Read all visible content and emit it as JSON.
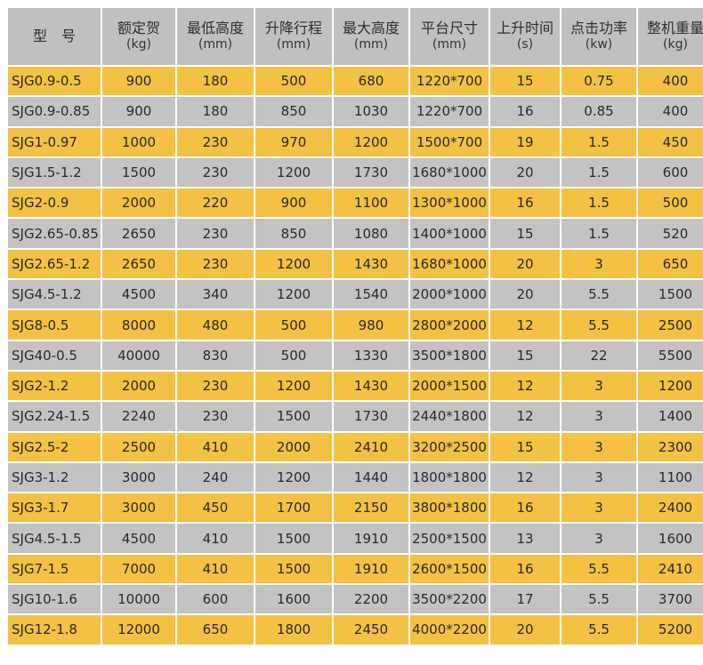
{
  "headers": [
    {
      "label": "型　号",
      "unit": ""
    },
    {
      "label": "额定贺",
      "unit": "(kg)"
    },
    {
      "label": "最低高度",
      "unit": "(mm)"
    },
    {
      "label": "升降行程",
      "unit": "(mm)"
    },
    {
      "label": "最大高度",
      "unit": "(mm)"
    },
    {
      "label": "平台尺寸",
      "unit": "(mm)"
    },
    {
      "label": "上升时间",
      "unit": "(s)"
    },
    {
      "label": "点击功率",
      "unit": "(kw)"
    },
    {
      "label": "整机重量",
      "unit": "(kg)"
    }
  ],
  "rows": [
    [
      "SJG0.9-0.5",
      "900",
      "180",
      "500",
      "680",
      "1220*700",
      "15",
      "0.75",
      "400"
    ],
    [
      "SJG0.9-0.85",
      "900",
      "180",
      "850",
      "1030",
      "1220*700",
      "16",
      "0.85",
      "400"
    ],
    [
      "SJG1-0.97",
      "1000",
      "230",
      "970",
      "1200",
      "1500*700",
      "19",
      "1.5",
      "450"
    ],
    [
      "SJG1.5-1.2",
      "1500",
      "230",
      "1200",
      "1730",
      "1680*1000",
      "20",
      "1.5",
      "600"
    ],
    [
      "SJG2-0.9",
      "2000",
      "220",
      "900",
      "1100",
      "1300*1000",
      "16",
      "1.5",
      "500"
    ],
    [
      "SJG2.65-0.85",
      "2650",
      "230",
      "850",
      "1080",
      "1400*1000",
      "15",
      "1.5",
      "520"
    ],
    [
      "SJG2.65-1.2",
      "2650",
      "230",
      "1200",
      "1430",
      "1680*1000",
      "20",
      "3",
      "650"
    ],
    [
      "SJG4.5-1.2",
      "4500",
      "340",
      "1200",
      "1540",
      "2000*1000",
      "20",
      "5.5",
      "1500"
    ],
    [
      "SJG8-0.5",
      "8000",
      "480",
      "500",
      "980",
      "2800*2000",
      "12",
      "5.5",
      "2500"
    ],
    [
      "SJG40-0.5",
      "40000",
      "830",
      "500",
      "1330",
      "3500*1800",
      "15",
      "22",
      "5500"
    ],
    [
      "SJG2-1.2",
      "2000",
      "230",
      "1200",
      "1430",
      "2000*1500",
      "12",
      "3",
      "1200"
    ],
    [
      "SJG2.24-1.5",
      "2240",
      "230",
      "1500",
      "1730",
      "2440*1800",
      "12",
      "3",
      "1400"
    ],
    [
      "SJG2.5-2",
      "2500",
      "410",
      "2000",
      "2410",
      "3200*2500",
      "15",
      "3",
      "2300"
    ],
    [
      "SJG3-1.2",
      "3000",
      "240",
      "1200",
      "1440",
      "1800*1800",
      "12",
      "3",
      "1100"
    ],
    [
      "SJG3-1.7",
      "3000",
      "450",
      "1700",
      "2150",
      "3800*1800",
      "16",
      "3",
      "2400"
    ],
    [
      "SJG4.5-1.5",
      "4500",
      "410",
      "1500",
      "1910",
      "2500*1500",
      "13",
      "3",
      "1600"
    ],
    [
      "SJG7-1.5",
      "7000",
      "410",
      "1500",
      "1910",
      "2600*1500",
      "16",
      "5.5",
      "2410"
    ],
    [
      "SJG10-1.6",
      "10000",
      "600",
      "1600",
      "2200",
      "3500*2200",
      "17",
      "5.5",
      "3700"
    ],
    [
      "SJG12-1.8",
      "12000",
      "650",
      "1800",
      "2450",
      "4000*2200",
      "20",
      "5.5",
      "5200"
    ]
  ],
  "colors": {
    "header": "#c0c0c0",
    "odd_row": "#f3c144",
    "even_row": "#c3c3c3"
  }
}
